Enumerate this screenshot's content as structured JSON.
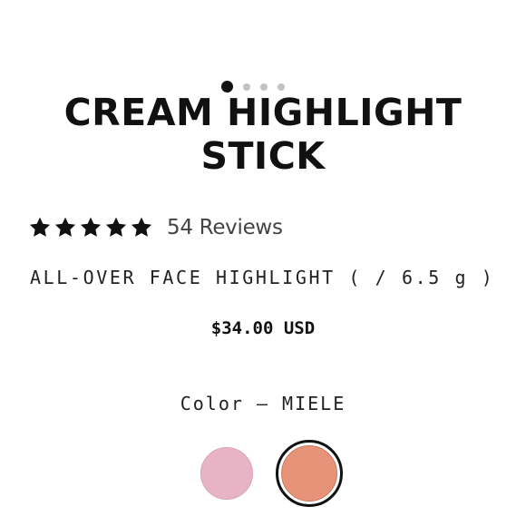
{
  "carousel": {
    "dots": [
      {
        "label": "Slide 1",
        "active": true
      },
      {
        "label": "Slide 2",
        "active": false
      },
      {
        "label": "Slide 3",
        "active": false
      },
      {
        "label": "Slide 4",
        "active": false
      }
    ]
  },
  "product": {
    "title_line1": "CREAM HIGHLIGHT",
    "title_line2": "STICK",
    "rating": {
      "stars": 5,
      "max": 5,
      "reviews_label": "54 Reviews",
      "star_color": "#111111"
    },
    "subtitle": "ALL-OVER FACE HIGHLIGHT ( / 6.5 g )",
    "price": "$34.00 USD",
    "color_label": "Color — MIELE"
  },
  "swatches": [
    {
      "name": "pink",
      "color": "#e9b3c6",
      "selected": false
    },
    {
      "name": "MIELE",
      "color": "#e6937a",
      "selected": true
    }
  ]
}
